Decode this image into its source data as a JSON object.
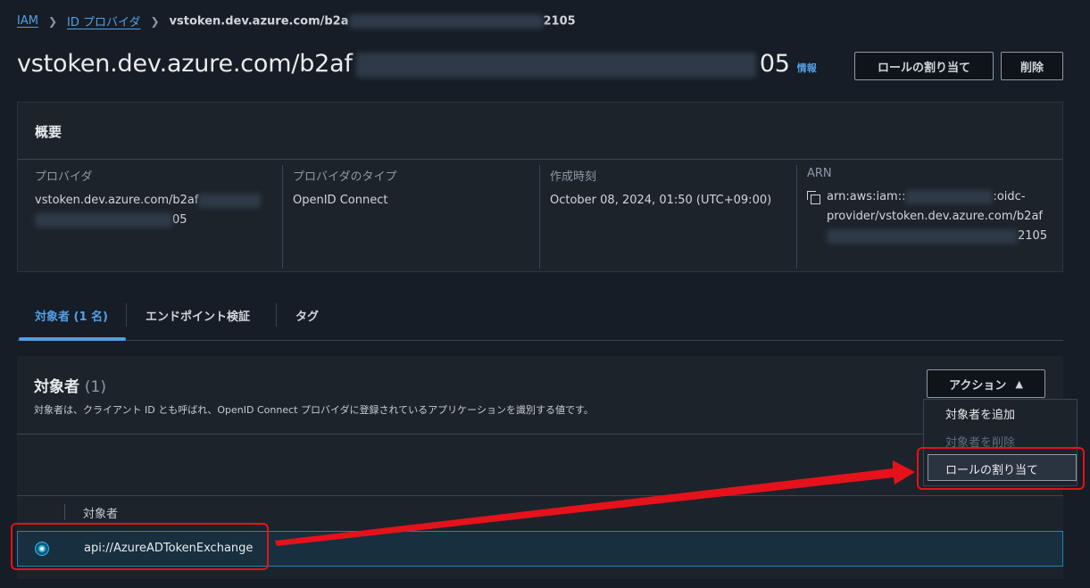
{
  "breadcrumb": {
    "iam": "IAM",
    "providers": "ID プロバイダ",
    "current_prefix": "vstoken.dev.azure.com/b2a",
    "current_suffix": "2105"
  },
  "page": {
    "title_prefix": "vstoken.dev.azure.com/b2af",
    "title_suffix": "05",
    "info": "情報"
  },
  "actions": {
    "assign_role": "ロールの割り当て",
    "delete": "削除"
  },
  "summary": {
    "heading": "概要",
    "provider_label": "プロバイダ",
    "provider_value_prefix": "vstoken.dev.azure.com/b2af",
    "provider_value_suffix": "05",
    "type_label": "プロバイダのタイプ",
    "type_value": "OpenID Connect",
    "created_label": "作成時刻",
    "created_value": "October 08, 2024, 01:50 (UTC+09:00)",
    "arn_label": "ARN",
    "arn_line1_prefix": "arn:aws:iam::",
    "arn_line1_suffix": ":oidc-",
    "arn_line2": "provider/vstoken.dev.azure.com/b2af",
    "arn_line3_suffix": "2105"
  },
  "tabs": [
    {
      "label": "対象者 (1 名)"
    },
    {
      "label": "エンドポイント検証"
    },
    {
      "label": "タグ"
    }
  ],
  "audience": {
    "title": "対象者",
    "count": "(1)",
    "description": "対象者は、クライアント ID とも呼ばれ、OpenID Connect プロバイダに登録されているアプリケーションを識別する値です。",
    "action_button": "アクション",
    "column_header": "対象者",
    "rows": [
      {
        "value": "api://AzureADTokenExchange"
      }
    ]
  },
  "dropdown": {
    "items": [
      {
        "label": "対象者を追加"
      },
      {
        "label": "対象者を削除"
      },
      {
        "label": "ロールの割り当て"
      }
    ]
  },
  "colors": {
    "link": "#539fe5",
    "annotation": "#e5121b",
    "selected_row": "#172f3f"
  }
}
